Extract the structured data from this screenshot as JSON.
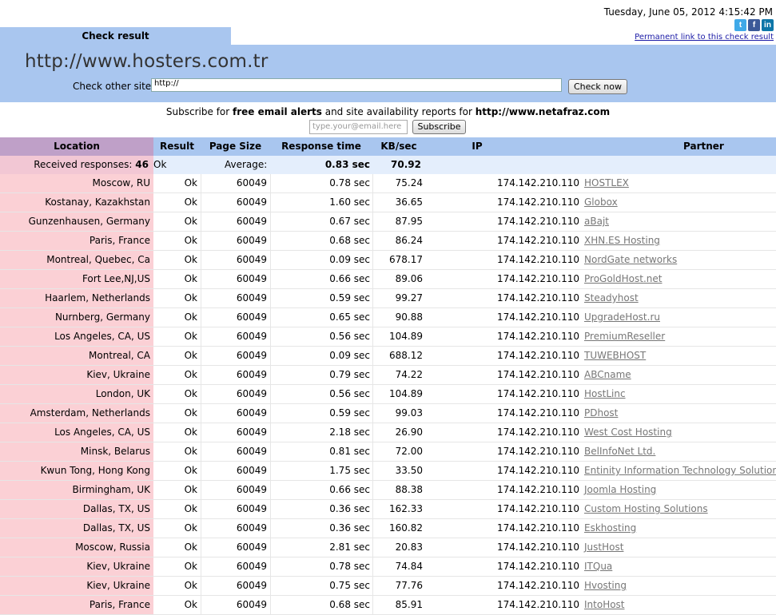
{
  "datetime": "Tuesday, June 05, 2012 4:15:42 PM",
  "social": {
    "twitter": "twitter-icon",
    "facebook": "facebook-icon",
    "linkedin": "linkedin-icon"
  },
  "permalink": "Permanent link to this check result",
  "tab_label": "Check result",
  "site_url": "http://www.hosters.com.tr",
  "check_other": {
    "label": "Check other site:",
    "value": "http://",
    "button": "Check now"
  },
  "subscribe": {
    "text_before": "Subscribe for ",
    "bold1": "free email alerts",
    "text_middle": " and site availability reports for ",
    "bold2": "http://www.netafraz.com",
    "email_placeholder": "type.your@email.here",
    "button": "Subscribe"
  },
  "table": {
    "headers": {
      "location": "Location",
      "result": "Result",
      "page_size": "Page Size",
      "response_time": "Response time",
      "kb_sec": "KB/sec",
      "ip": "IP",
      "partner": "Partner"
    },
    "summary": {
      "label": "Received responses:",
      "count": "46",
      "ok": "Ok",
      "average_label": "Average:",
      "avg_time": "0.83 sec",
      "avg_kb": "70.92"
    },
    "rows": [
      {
        "location": "Moscow, RU",
        "result": "Ok",
        "size": "60049",
        "time": "0.78 sec",
        "kb": "75.24",
        "ip": "174.142.210.110",
        "partner": "HOSTLEX"
      },
      {
        "location": "Kostanay, Kazakhstan",
        "result": "Ok",
        "size": "60049",
        "time": "1.60 sec",
        "kb": "36.65",
        "ip": "174.142.210.110",
        "partner": "Globox"
      },
      {
        "location": "Gunzenhausen, Germany",
        "result": "Ok",
        "size": "60049",
        "time": "0.67 sec",
        "kb": "87.95",
        "ip": "174.142.210.110",
        "partner": "aBajt"
      },
      {
        "location": "Paris, France",
        "result": "Ok",
        "size": "60049",
        "time": "0.68 sec",
        "kb": "86.24",
        "ip": "174.142.210.110",
        "partner": "XHN.ES Hosting"
      },
      {
        "location": "Montreal, Quebec, Ca",
        "result": "Ok",
        "size": "60049",
        "time": "0.09 sec",
        "kb": "678.17",
        "ip": "174.142.210.110",
        "partner": "NordGate networks"
      },
      {
        "location": "Fort Lee,NJ,US",
        "result": "Ok",
        "size": "60049",
        "time": "0.66 sec",
        "kb": "89.06",
        "ip": "174.142.210.110",
        "partner": "ProGoldHost.net"
      },
      {
        "location": "Haarlem, Netherlands",
        "result": "Ok",
        "size": "60049",
        "time": "0.59 sec",
        "kb": "99.27",
        "ip": "174.142.210.110",
        "partner": "Steadyhost"
      },
      {
        "location": "Nurnberg, Germany",
        "result": "Ok",
        "size": "60049",
        "time": "0.65 sec",
        "kb": "90.88",
        "ip": "174.142.210.110",
        "partner": "UpgradeHost.ru"
      },
      {
        "location": "Los Angeles, CA, US",
        "result": "Ok",
        "size": "60049",
        "time": "0.56 sec",
        "kb": "104.89",
        "ip": "174.142.210.110",
        "partner": "PremiumReseller"
      },
      {
        "location": "Montreal, CA",
        "result": "Ok",
        "size": "60049",
        "time": "0.09 sec",
        "kb": "688.12",
        "ip": "174.142.210.110",
        "partner": "TUWEBHOST"
      },
      {
        "location": "Kiev, Ukraine",
        "result": "Ok",
        "size": "60049",
        "time": "0.79 sec",
        "kb": "74.22",
        "ip": "174.142.210.110",
        "partner": "ABCname"
      },
      {
        "location": "London, UK",
        "result": "Ok",
        "size": "60049",
        "time": "0.56 sec",
        "kb": "104.89",
        "ip": "174.142.210.110",
        "partner": "HostLinc"
      },
      {
        "location": "Amsterdam, Netherlands",
        "result": "Ok",
        "size": "60049",
        "time": "0.59 sec",
        "kb": "99.03",
        "ip": "174.142.210.110",
        "partner": "PDhost"
      },
      {
        "location": "Los Angeles, CA, US",
        "result": "Ok",
        "size": "60049",
        "time": "2.18 sec",
        "kb": "26.90",
        "ip": "174.142.210.110",
        "partner": "West Cost Hosting"
      },
      {
        "location": "Minsk, Belarus",
        "result": "Ok",
        "size": "60049",
        "time": "0.81 sec",
        "kb": "72.00",
        "ip": "174.142.210.110",
        "partner": "BelInfoNet Ltd."
      },
      {
        "location": "Kwun Tong, Hong Kong",
        "result": "Ok",
        "size": "60049",
        "time": "1.75 sec",
        "kb": "33.50",
        "ip": "174.142.210.110",
        "partner": "Entinity Information Technology Solutions"
      },
      {
        "location": "Birmingham, UK",
        "result": "Ok",
        "size": "60049",
        "time": "0.66 sec",
        "kb": "88.38",
        "ip": "174.142.210.110",
        "partner": "Joomla Hosting"
      },
      {
        "location": "Dallas, TX, US",
        "result": "Ok",
        "size": "60049",
        "time": "0.36 sec",
        "kb": "162.33",
        "ip": "174.142.210.110",
        "partner": "Custom Hosting Solutions"
      },
      {
        "location": "Dallas, TX, US",
        "result": "Ok",
        "size": "60049",
        "time": "0.36 sec",
        "kb": "160.82",
        "ip": "174.142.210.110",
        "partner": "Eskhosting"
      },
      {
        "location": "Moscow, Russia",
        "result": "Ok",
        "size": "60049",
        "time": "2.81 sec",
        "kb": "20.83",
        "ip": "174.142.210.110",
        "partner": "JustHost"
      },
      {
        "location": "Kiev, Ukraine",
        "result": "Ok",
        "size": "60049",
        "time": "0.78 sec",
        "kb": "74.84",
        "ip": "174.142.210.110",
        "partner": "ITQua"
      },
      {
        "location": "Kiev, Ukraine",
        "result": "Ok",
        "size": "60049",
        "time": "0.75 sec",
        "kb": "77.76",
        "ip": "174.142.210.110",
        "partner": "Hvosting"
      },
      {
        "location": "Paris, France",
        "result": "Ok",
        "size": "60049",
        "time": "0.68 sec",
        "kb": "85.91",
        "ip": "174.142.210.110",
        "partner": "IntoHost"
      }
    ]
  }
}
